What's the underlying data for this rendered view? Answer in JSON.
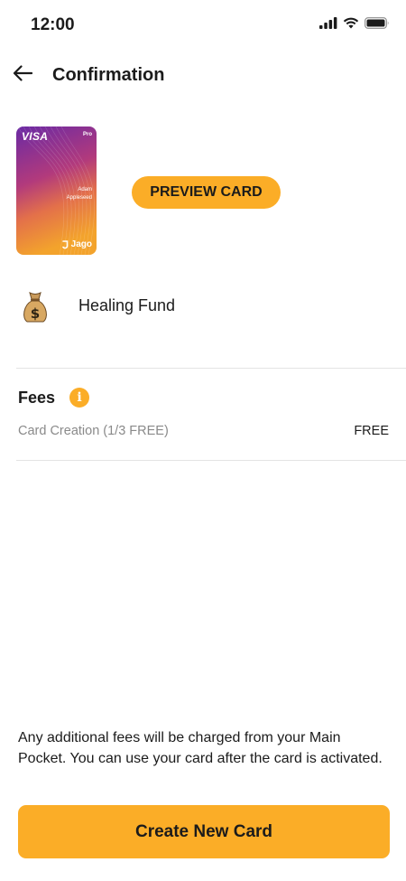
{
  "status_bar": {
    "time": "12:00",
    "icons": [
      "cellular-signal-icon",
      "wifi-icon",
      "battery-icon"
    ]
  },
  "header": {
    "title": "Confirmation",
    "back_icon": "arrow-left-icon"
  },
  "card": {
    "network": "VISA",
    "tier": "Pro",
    "holder_first": "Adam",
    "holder_last": "Appleseed",
    "brand": "Jago",
    "colors": {
      "top": "#6a2aa4",
      "middle": "#c2446a",
      "bottom": "#f3a32c"
    }
  },
  "preview_button": {
    "label": "PREVIEW CARD"
  },
  "pocket": {
    "icon": "money-bag-icon",
    "name": "Healing Fund"
  },
  "fees": {
    "title": "Fees",
    "info_icon": "info-icon",
    "items": [
      {
        "label": "Card Creation (1/3 FREE)",
        "value": "FREE"
      }
    ]
  },
  "notice": "Any additional fees will be charged from your Main Pocket. You can use your card after the card is activated.",
  "create_button": {
    "label": "Create New Card"
  },
  "theme": {
    "accent": "#fbad27",
    "divider": "#e4e4e4",
    "muted_text": "#8a8a8a",
    "text": "#1b1b1b"
  }
}
